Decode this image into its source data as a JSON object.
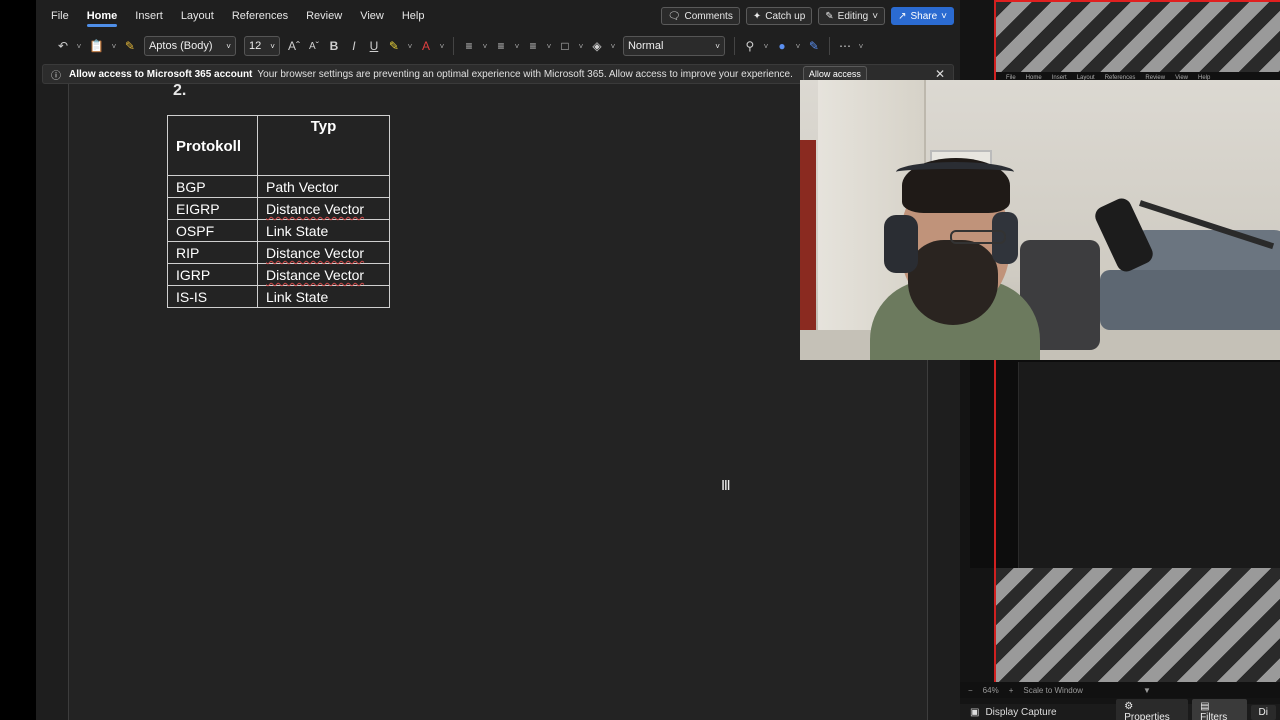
{
  "menu": {
    "tabs": [
      "File",
      "Home",
      "Insert",
      "Layout",
      "References",
      "Review",
      "View",
      "Help"
    ],
    "active": "Home"
  },
  "top_actions": {
    "comments": "Comments",
    "catch_up": "Catch up",
    "editing": "Editing",
    "share": "Share"
  },
  "ribbon": {
    "font_name": "Aptos (Body)",
    "font_size": "12",
    "style": "Normal"
  },
  "infobar": {
    "title": "Allow access to Microsoft 365 account",
    "message": "Your browser settings are preventing an optimal experience with Microsoft 365. Allow access to improve your experience.",
    "button": "Allow access"
  },
  "document": {
    "heading_number": "2.",
    "table": {
      "headers": [
        "Protokoll",
        "Typ"
      ],
      "rows": [
        [
          "BGP",
          "Path Vector"
        ],
        [
          "EIGRP",
          "Distance Vector"
        ],
        [
          "OSPF",
          "Link State"
        ],
        [
          "RIP",
          "Distance Vector"
        ],
        [
          "IGRP",
          "Distance Vector"
        ],
        [
          "IS-IS",
          "Link State"
        ]
      ]
    }
  },
  "obs": {
    "mini_menu": [
      "File",
      "Home",
      "Insert",
      "Layout",
      "References",
      "Review",
      "View",
      "Help"
    ],
    "zoom": "64%",
    "scale": "Scale to Window",
    "source": "Display Capture",
    "properties": "Properties",
    "filters": "Filters",
    "cut_tab": "Di"
  }
}
